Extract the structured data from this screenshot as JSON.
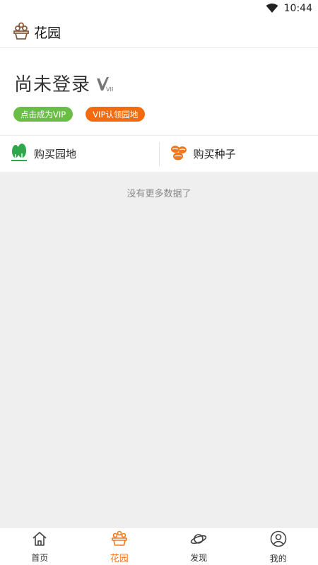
{
  "status_bar": {
    "time": "10:44"
  },
  "header": {
    "title": "花园"
  },
  "profile": {
    "name": "尚未登录",
    "vip_badge_text": "VIP",
    "become_vip_label": "点击成为VIP",
    "vip_claim_label": "VIP认领园地"
  },
  "quick_actions": {
    "buy_garden_label": "购买园地",
    "buy_seeds_label": "购买种子"
  },
  "content": {
    "empty_text": "没有更多数据了"
  },
  "tabs": [
    {
      "label": "首页",
      "icon": "home-icon"
    },
    {
      "label": "花园",
      "icon": "garden-icon",
      "active": true
    },
    {
      "label": "发现",
      "icon": "planet-icon"
    },
    {
      "label": "我的",
      "icon": "user-icon"
    }
  ],
  "colors": {
    "accent": "#f07820",
    "green_badge": "#6abe45",
    "orange_badge": "#f26c0f",
    "garden_icon": "#2ea84a",
    "seeds_icon": "#f07820",
    "content_bg": "#efefef"
  }
}
